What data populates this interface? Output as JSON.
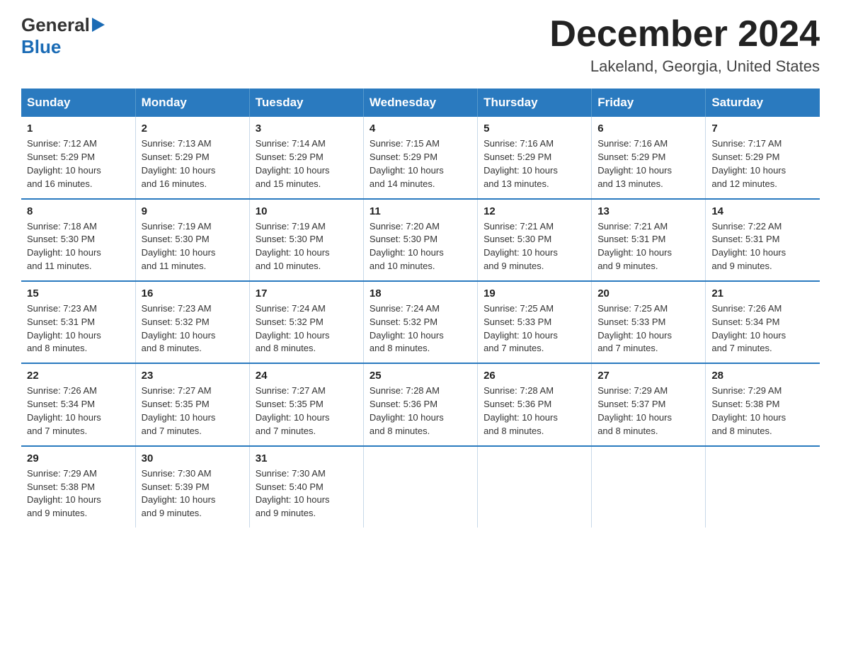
{
  "logo": {
    "line1": "General",
    "arrow": "▶",
    "line2": "Blue"
  },
  "title": "December 2024",
  "location": "Lakeland, Georgia, United States",
  "days_of_week": [
    "Sunday",
    "Monday",
    "Tuesday",
    "Wednesday",
    "Thursday",
    "Friday",
    "Saturday"
  ],
  "weeks": [
    [
      {
        "day": "1",
        "sunrise": "7:12 AM",
        "sunset": "5:29 PM",
        "daylight": "10 hours and 16 minutes."
      },
      {
        "day": "2",
        "sunrise": "7:13 AM",
        "sunset": "5:29 PM",
        "daylight": "10 hours and 16 minutes."
      },
      {
        "day": "3",
        "sunrise": "7:14 AM",
        "sunset": "5:29 PM",
        "daylight": "10 hours and 15 minutes."
      },
      {
        "day": "4",
        "sunrise": "7:15 AM",
        "sunset": "5:29 PM",
        "daylight": "10 hours and 14 minutes."
      },
      {
        "day": "5",
        "sunrise": "7:16 AM",
        "sunset": "5:29 PM",
        "daylight": "10 hours and 13 minutes."
      },
      {
        "day": "6",
        "sunrise": "7:16 AM",
        "sunset": "5:29 PM",
        "daylight": "10 hours and 13 minutes."
      },
      {
        "day": "7",
        "sunrise": "7:17 AM",
        "sunset": "5:29 PM",
        "daylight": "10 hours and 12 minutes."
      }
    ],
    [
      {
        "day": "8",
        "sunrise": "7:18 AM",
        "sunset": "5:30 PM",
        "daylight": "10 hours and 11 minutes."
      },
      {
        "day": "9",
        "sunrise": "7:19 AM",
        "sunset": "5:30 PM",
        "daylight": "10 hours and 11 minutes."
      },
      {
        "day": "10",
        "sunrise": "7:19 AM",
        "sunset": "5:30 PM",
        "daylight": "10 hours and 10 minutes."
      },
      {
        "day": "11",
        "sunrise": "7:20 AM",
        "sunset": "5:30 PM",
        "daylight": "10 hours and 10 minutes."
      },
      {
        "day": "12",
        "sunrise": "7:21 AM",
        "sunset": "5:30 PM",
        "daylight": "10 hours and 9 minutes."
      },
      {
        "day": "13",
        "sunrise": "7:21 AM",
        "sunset": "5:31 PM",
        "daylight": "10 hours and 9 minutes."
      },
      {
        "day": "14",
        "sunrise": "7:22 AM",
        "sunset": "5:31 PM",
        "daylight": "10 hours and 9 minutes."
      }
    ],
    [
      {
        "day": "15",
        "sunrise": "7:23 AM",
        "sunset": "5:31 PM",
        "daylight": "10 hours and 8 minutes."
      },
      {
        "day": "16",
        "sunrise": "7:23 AM",
        "sunset": "5:32 PM",
        "daylight": "10 hours and 8 minutes."
      },
      {
        "day": "17",
        "sunrise": "7:24 AM",
        "sunset": "5:32 PM",
        "daylight": "10 hours and 8 minutes."
      },
      {
        "day": "18",
        "sunrise": "7:24 AM",
        "sunset": "5:32 PM",
        "daylight": "10 hours and 8 minutes."
      },
      {
        "day": "19",
        "sunrise": "7:25 AM",
        "sunset": "5:33 PM",
        "daylight": "10 hours and 7 minutes."
      },
      {
        "day": "20",
        "sunrise": "7:25 AM",
        "sunset": "5:33 PM",
        "daylight": "10 hours and 7 minutes."
      },
      {
        "day": "21",
        "sunrise": "7:26 AM",
        "sunset": "5:34 PM",
        "daylight": "10 hours and 7 minutes."
      }
    ],
    [
      {
        "day": "22",
        "sunrise": "7:26 AM",
        "sunset": "5:34 PM",
        "daylight": "10 hours and 7 minutes."
      },
      {
        "day": "23",
        "sunrise": "7:27 AM",
        "sunset": "5:35 PM",
        "daylight": "10 hours and 7 minutes."
      },
      {
        "day": "24",
        "sunrise": "7:27 AM",
        "sunset": "5:35 PM",
        "daylight": "10 hours and 7 minutes."
      },
      {
        "day": "25",
        "sunrise": "7:28 AM",
        "sunset": "5:36 PM",
        "daylight": "10 hours and 8 minutes."
      },
      {
        "day": "26",
        "sunrise": "7:28 AM",
        "sunset": "5:36 PM",
        "daylight": "10 hours and 8 minutes."
      },
      {
        "day": "27",
        "sunrise": "7:29 AM",
        "sunset": "5:37 PM",
        "daylight": "10 hours and 8 minutes."
      },
      {
        "day": "28",
        "sunrise": "7:29 AM",
        "sunset": "5:38 PM",
        "daylight": "10 hours and 8 minutes."
      }
    ],
    [
      {
        "day": "29",
        "sunrise": "7:29 AM",
        "sunset": "5:38 PM",
        "daylight": "10 hours and 9 minutes."
      },
      {
        "day": "30",
        "sunrise": "7:30 AM",
        "sunset": "5:39 PM",
        "daylight": "10 hours and 9 minutes."
      },
      {
        "day": "31",
        "sunrise": "7:30 AM",
        "sunset": "5:40 PM",
        "daylight": "10 hours and 9 minutes."
      },
      null,
      null,
      null,
      null
    ]
  ],
  "labels": {
    "sunrise": "Sunrise:",
    "sunset": "Sunset:",
    "daylight": "Daylight:"
  }
}
